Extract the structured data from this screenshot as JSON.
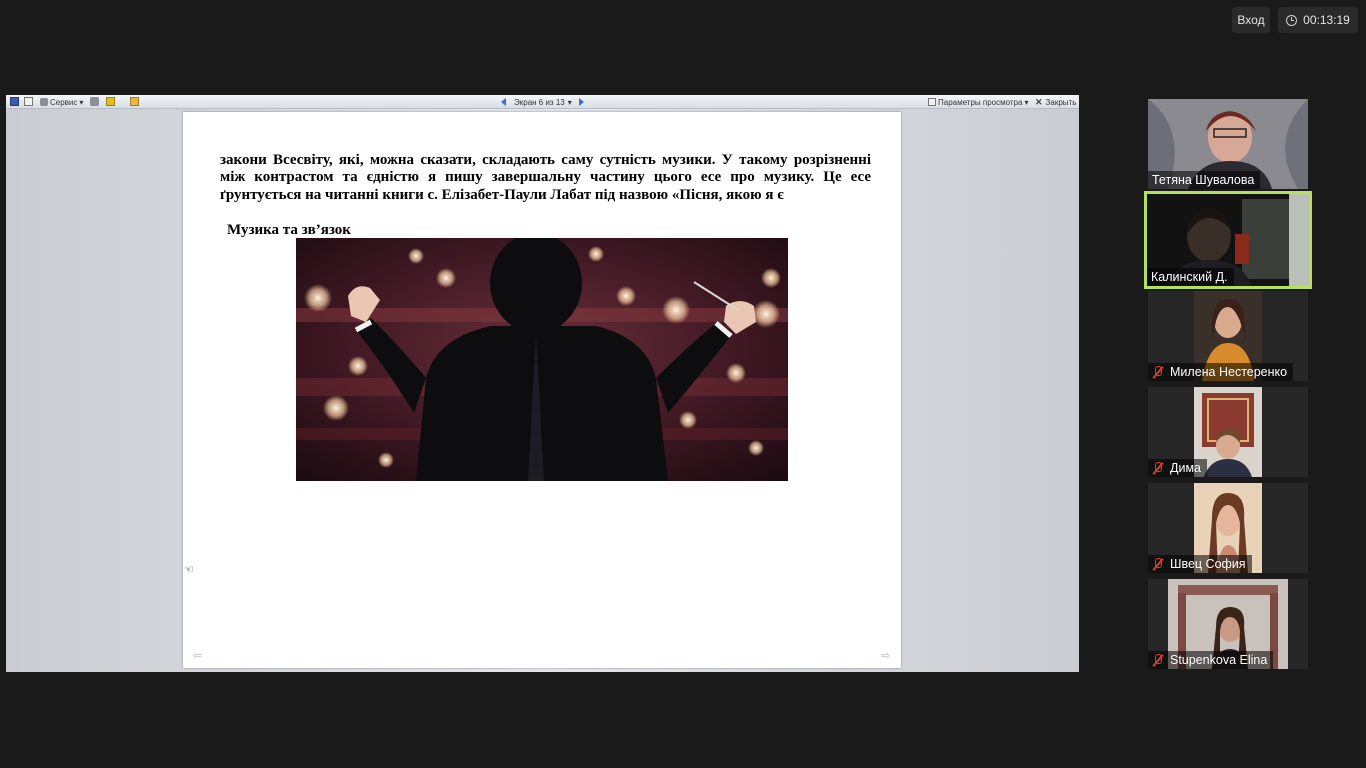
{
  "header": {
    "login_label": "Вход",
    "timer": "00:13:19"
  },
  "viewer": {
    "tools_label": "Сервис",
    "page_indicator": "Экран 6 из 13",
    "view_options_label": "Параметры просмотра",
    "close_label": "Закрыть"
  },
  "document": {
    "paragraph": "закони Всесвіту, які, можна сказати, складають саму сутність музики. У такому розрізненні між контрастом та єдністю я пишу завершальну частину цього есе про музику. Це есе ґрунтується на читанні книги с. Елізабет-Паули Лабат під назвою «Пісня, якою я є",
    "heading": "Музика та зв’язок"
  },
  "participants": [
    {
      "name": "Тетяна Шувалова",
      "muted": false,
      "active": false
    },
    {
      "name": "Калинский Д.",
      "muted": false,
      "active": true
    },
    {
      "name": "Милена Нестеренко",
      "muted": true,
      "active": false
    },
    {
      "name": "Дима",
      "muted": true,
      "active": false
    },
    {
      "name": "Швец София",
      "muted": true,
      "active": false
    },
    {
      "name": "Stupenkova Elina",
      "muted": true,
      "active": false
    }
  ],
  "colors": {
    "active_speaker_border": "#b7e05a",
    "muted_icon": "#e53935",
    "background": "#1a1a1a"
  }
}
